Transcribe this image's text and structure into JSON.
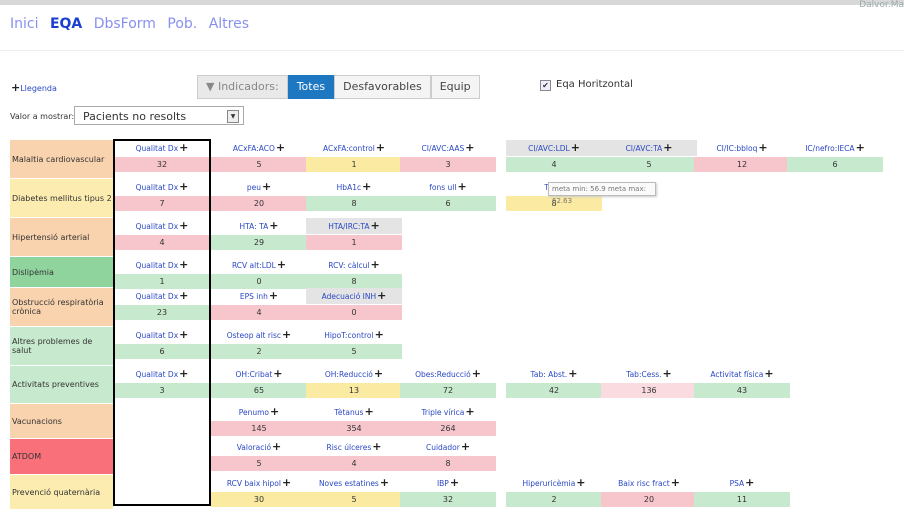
{
  "topright": "Dalvor.Ma",
  "nav": [
    "Inici",
    "EQA",
    "DbsForm",
    "Pob.",
    "Altres"
  ],
  "nav_active": 1,
  "legend": "Llegenda",
  "filters": {
    "label": "Indicadors:",
    "buttons": [
      "Totes",
      "Desfavorables",
      "Equip"
    ],
    "selected": 0
  },
  "horizontal": {
    "label": "Eqa Horitzontal",
    "checked": true
  },
  "valor": {
    "label": "Valor a mostrar:",
    "value": "Pacients no resolts"
  },
  "tooltip": "meta min: 56.9 meta max: 62.63",
  "colors": {
    "red": "#f7c6cc",
    "green": "#c7e9cd",
    "yellow": "#fbeaa1",
    "lightred": "#fadbe0",
    "gray": "#e4e4e4"
  },
  "rows": [
    {
      "label": "Malaltia cardiovascular",
      "bg": "#f9d2ae",
      "cells": [
        {
          "name": "Qualitat Dx",
          "value": "32",
          "color": "red"
        },
        {
          "name": "ACxFA:ACO",
          "value": "5",
          "color": "red"
        },
        {
          "name": "ACxFA:control",
          "value": "1",
          "color": "yellow"
        },
        {
          "name": "CI/AVC:AAS",
          "value": "3",
          "color": "red"
        },
        {
          "name": "CI/AVC:LDL",
          "value": "4",
          "color": "green",
          "head": "gray"
        },
        {
          "name": "CI/AVC:TA",
          "value": "5",
          "color": "green",
          "head": "gray"
        },
        {
          "name": "CI/IC:bbloq",
          "value": "12",
          "color": "red"
        },
        {
          "name": "IC/nefro:IECA",
          "value": "6",
          "color": "green"
        }
      ]
    },
    {
      "label": "Diabetes mellitus tipus 2",
      "bg": "#fcecb0",
      "cells": [
        {
          "name": "Qualitat Dx",
          "value": "7",
          "color": "red"
        },
        {
          "name": "peu",
          "value": "20",
          "color": "red"
        },
        {
          "name": "HbA1c",
          "value": "8",
          "color": "green"
        },
        {
          "name": "fons ull",
          "value": "6",
          "color": "green"
        },
        {
          "name": "TA",
          "value": "8",
          "color": "yellow"
        }
      ]
    },
    {
      "label": "Hipertensió arterial",
      "bg": "#f9d2ae",
      "cells": [
        {
          "name": "Qualitat Dx",
          "value": "4",
          "color": "red"
        },
        {
          "name": "HTA: TA",
          "value": "29",
          "color": "green"
        },
        {
          "name": "HTA/IRC:TA",
          "value": "1",
          "color": "red",
          "head": "gray"
        }
      ]
    },
    {
      "label": "Dislipèmia",
      "bg": "#8fd39d",
      "cells": [
        {
          "name": "Qualitat Dx",
          "value": "1",
          "color": "green"
        },
        {
          "name": "RCV alt:LDL",
          "value": "0",
          "color": "green"
        },
        {
          "name": "RCV: càlcul",
          "value": "8",
          "color": "green"
        }
      ]
    },
    {
      "label": "Obstrucció respiratòria crònica",
      "bg": "#f9d2ae",
      "cells": [
        {
          "name": "Qualitat Dx",
          "value": "23",
          "color": "green"
        },
        {
          "name": "EPS inh",
          "value": "4",
          "color": "red"
        },
        {
          "name": "Adecuació INH",
          "value": "0",
          "color": "red",
          "head": "gray"
        }
      ]
    },
    {
      "label": "Altres problemes de salut",
      "bg": "#c7e9cd",
      "cells": [
        {
          "name": "Qualitat Dx",
          "value": "6",
          "color": "green"
        },
        {
          "name": "Osteop alt risc",
          "value": "2",
          "color": "green"
        },
        {
          "name": "HipoT:control",
          "value": "5",
          "color": "green"
        }
      ]
    },
    {
      "label": "Activitats preventives",
      "bg": "#c7e9cd",
      "cells": [
        {
          "name": "Qualitat Dx",
          "value": "3",
          "color": "green"
        },
        {
          "name": "OH:Cribat",
          "value": "65",
          "color": "green"
        },
        {
          "name": "OH:Reducció",
          "value": "13",
          "color": "yellow"
        },
        {
          "name": "Obes:Reducció",
          "value": "72",
          "color": "green"
        },
        {
          "name": "Tab: Abst.",
          "value": "42",
          "color": "green"
        },
        {
          "name": "Tab:Cess.",
          "value": "136",
          "color": "lightred"
        },
        {
          "name": "Activitat física",
          "value": "43",
          "color": "green"
        }
      ]
    },
    {
      "label": "Vacunacions",
      "bg": "#f9d2ae",
      "cells": [
        null,
        {
          "name": "Penumo",
          "value": "145",
          "color": "red"
        },
        {
          "name": "Tètanus",
          "value": "354",
          "color": "red"
        },
        {
          "name": "Triple vírica",
          "value": "264",
          "color": "red"
        }
      ]
    },
    {
      "label": "ATDOM",
      "bg": "#f96f7a",
      "cells": [
        null,
        {
          "name": "Valoració",
          "value": "5",
          "color": "red"
        },
        {
          "name": "Risc úlceres",
          "value": "4",
          "color": "red"
        },
        {
          "name": "Cuidador",
          "value": "8",
          "color": "red"
        }
      ]
    },
    {
      "label": "Prevenció quaternària",
      "bg": "#fcecb0",
      "cells": [
        null,
        {
          "name": "RCV baix hipol",
          "value": "30",
          "color": "yellow"
        },
        {
          "name": "Noves estatines",
          "value": "5",
          "color": "yellow"
        },
        {
          "name": "IBP",
          "value": "32",
          "color": "green"
        },
        {
          "name": "Hiperuricèmia",
          "value": "2",
          "color": "green"
        },
        {
          "name": "Baix risc fract",
          "value": "20",
          "color": "red"
        },
        {
          "name": "PSA",
          "value": "11",
          "color": "green"
        }
      ]
    }
  ]
}
